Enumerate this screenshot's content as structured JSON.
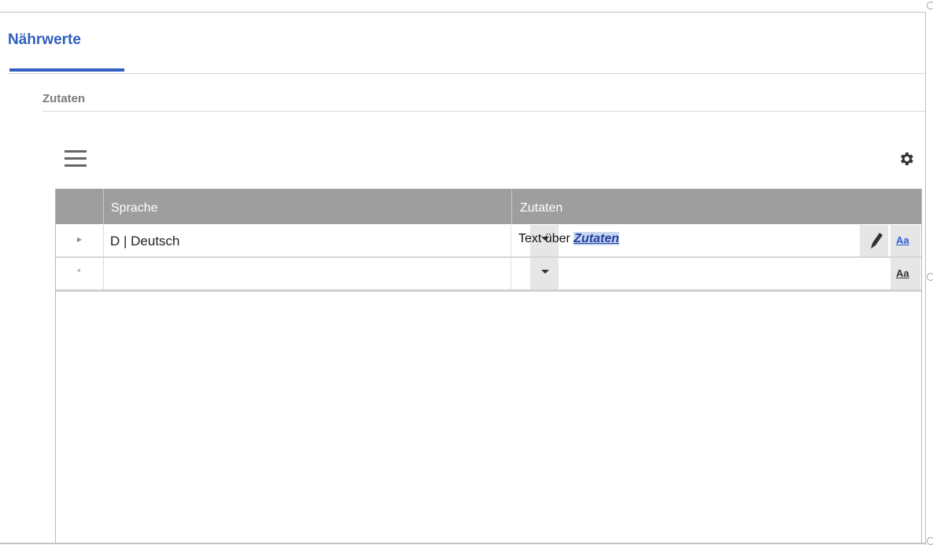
{
  "tabs": {
    "main_label": "Nährwerte",
    "sub_label": "Zutaten"
  },
  "grid": {
    "columns": [
      "Sprache",
      "Zutaten"
    ],
    "rows": [
      {
        "marker": "▸",
        "language": "D | Deutsch",
        "ingredients_prefix": "Text über ",
        "ingredients_link": "Zutaten",
        "format_label": "Aa"
      },
      {
        "marker": "*",
        "language": "",
        "ingredients_prefix": "",
        "ingredients_link": "",
        "format_label": "Aa"
      }
    ]
  },
  "icons": {
    "menu": "hamburger-menu-icon",
    "settings": "gear-icon",
    "dropdown": "chevron-down-icon",
    "edit": "pencil-icon",
    "format": "text-format-icon"
  },
  "colors": {
    "accent": "#2f5fbf",
    "header_bg": "#9e9e9e",
    "link_text": "#1f3f9f",
    "link_highlight": "#c9d6f0",
    "format_active": "#2a5bd7",
    "format_inactive": "#333333"
  }
}
